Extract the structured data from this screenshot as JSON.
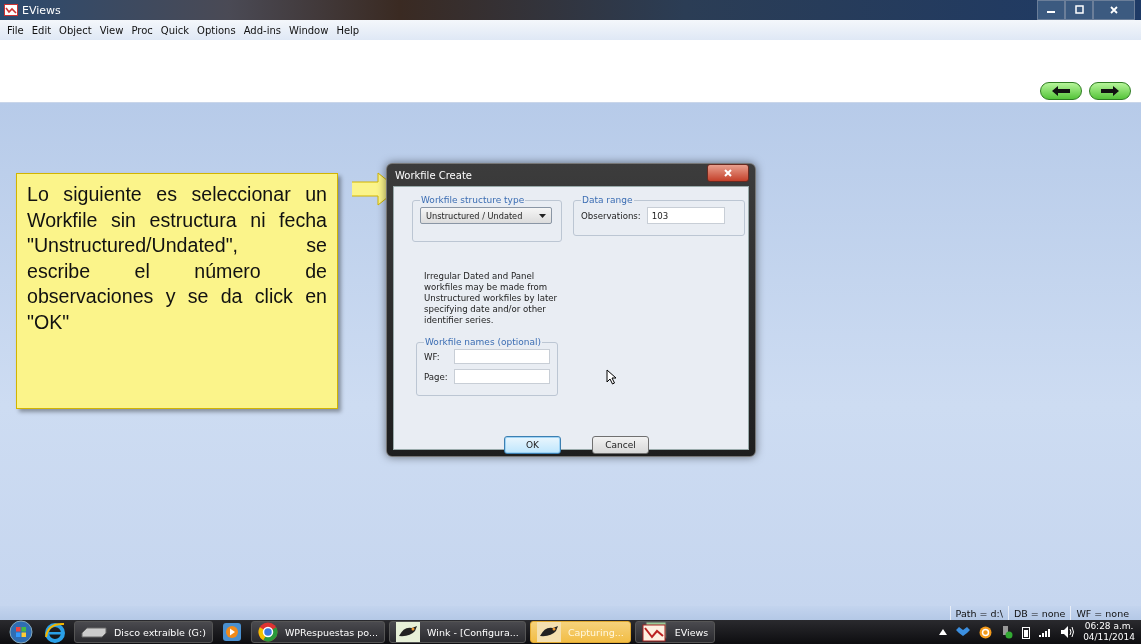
{
  "window": {
    "title": "EViews"
  },
  "menu": [
    "File",
    "Edit",
    "Object",
    "View",
    "Proc",
    "Quick",
    "Options",
    "Add-ins",
    "Window",
    "Help"
  ],
  "nav_buttons": [
    {
      "kind": "back"
    },
    {
      "kind": "forward"
    }
  ],
  "callout": {
    "text": "Lo siguiente es seleccionar un Workfile sin estructura ni fecha \"Unstructured/Undated\", se escribe el número de observaciones y se da click en \"OK\""
  },
  "dialog": {
    "title": "Workfile Create",
    "structure": {
      "title": "Workfile structure type",
      "value": "Unstructured / Undated",
      "note": "Irregular Dated and Panel workfiles may be made from Unstructured workfiles by later specifying date and/or other identifier series."
    },
    "data_range": {
      "title": "Data range",
      "label": "Observations:",
      "value": "103"
    },
    "names": {
      "title": "Workfile names (optional)",
      "fields": [
        {
          "label": "WF:"
        },
        {
          "label": "Page:"
        }
      ]
    },
    "buttons": [
      {
        "label": "OK",
        "default": true
      },
      {
        "label": "Cancel",
        "default": false
      }
    ]
  },
  "status_bar": [
    "Path = d:\\",
    "DB = none",
    "WF = none"
  ],
  "taskbar": {
    "items": [
      {
        "label": "Disco extraíble (G:)",
        "highlighted": false
      },
      {
        "label": "WPRespuestas po...",
        "highlighted": false
      },
      {
        "label": "Wink - [Configura...",
        "highlighted": false
      },
      {
        "label": "Capturing...",
        "highlighted": true
      },
      {
        "label": "EViews",
        "highlighted": false
      }
    ],
    "clock": {
      "time": "06:28 a.m.",
      "date": "04/11/2014"
    }
  }
}
